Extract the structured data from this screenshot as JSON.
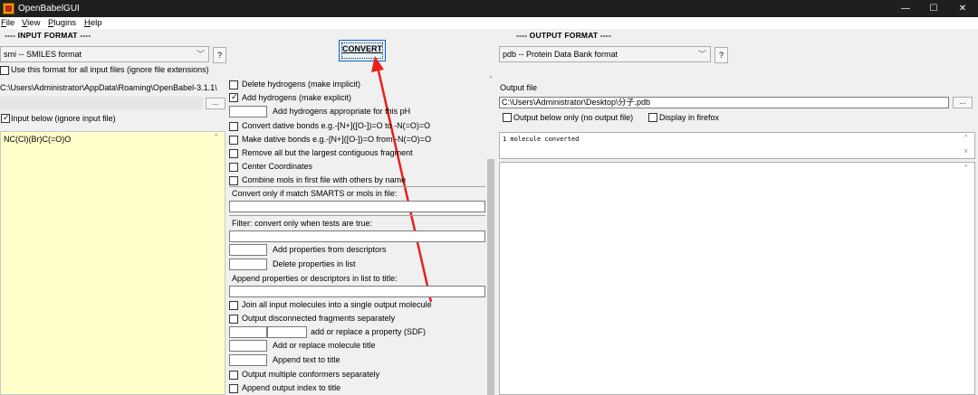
{
  "window": {
    "title": "OpenBabelGUI",
    "controls": {
      "minimize": "—",
      "maximize": "☐",
      "close": "✕"
    }
  },
  "menu": [
    {
      "hotkey": "F",
      "rest": "ile"
    },
    {
      "hotkey": "V",
      "rest": "iew"
    },
    {
      "hotkey": "P",
      "rest": "lugins"
    },
    {
      "hotkey": "H",
      "rest": "elp"
    }
  ],
  "input": {
    "header": "---- INPUT FORMAT ----",
    "format_value": "smi -- SMILES format",
    "help_label": "?",
    "use_for_all_label": "Use this format for all input files (ignore file extensions)",
    "use_for_all_checked": false,
    "file_path": "C:\\Users\\Administrator\\AppData\\Roaming\\OpenBabel-3.1.1\\",
    "browse_label": "...",
    "input_below_label": "Input below (ignore input file)",
    "input_below_checked": true,
    "text": "NC(Cl)(Br)C(=O)O"
  },
  "convert_label": "CONVERT",
  "options": {
    "delete_h": "Delete hydrogens (make implicit)",
    "add_h": "Add hydrogens (make explicit)",
    "add_h_ph": "Add hydrogens appropriate for this pH",
    "convert_dative": "Convert dative bonds e.g.-[N+]([O-])=O to -N(=O)=O",
    "make_dative": "Make dative bonds e.g.-[N+]([O-])=O from -N(=O)=O",
    "remove_small": "Remove all but the largest contiguous fragment",
    "center": "Center Coordinates",
    "combine": "Combine mols in first file with others by name",
    "smarts_label": "Convert only if match SMARTS or mols in file:",
    "filter_label": "Filter: convert only when tests are true:",
    "add_props": "Add properties from descriptors",
    "delete_props": "Delete properties in list",
    "append_props_label": "Append properties or descriptors in list to title:",
    "join_all": "Join all input molecules into a single output molecule",
    "output_fragments": "Output disconnected fragments separately",
    "add_replace_prop": "add or replace a property (SDF)",
    "add_replace_title": "Add or replace molecule title",
    "append_text": "Append text to title",
    "multi_conformers": "Output multiple conformers separately",
    "append_index": "Append output index to title"
  },
  "output": {
    "header": "---- OUTPUT FORMAT ----",
    "format_value": "pdb -- Protein Data Bank format",
    "help_label": "?",
    "file_label": "Output file",
    "file_path": "C:\\Users\\Administrator\\Desktop\\分子.pdb",
    "browse_label": "...",
    "output_below_label": "Output below only (no output file)",
    "display_firefox_label": "Display in firefox",
    "message": "1 molecule converted"
  },
  "colors": {
    "input_bg": "#ffffcc",
    "arrow": "#e8201c",
    "convert_border": "#0a64c8"
  }
}
